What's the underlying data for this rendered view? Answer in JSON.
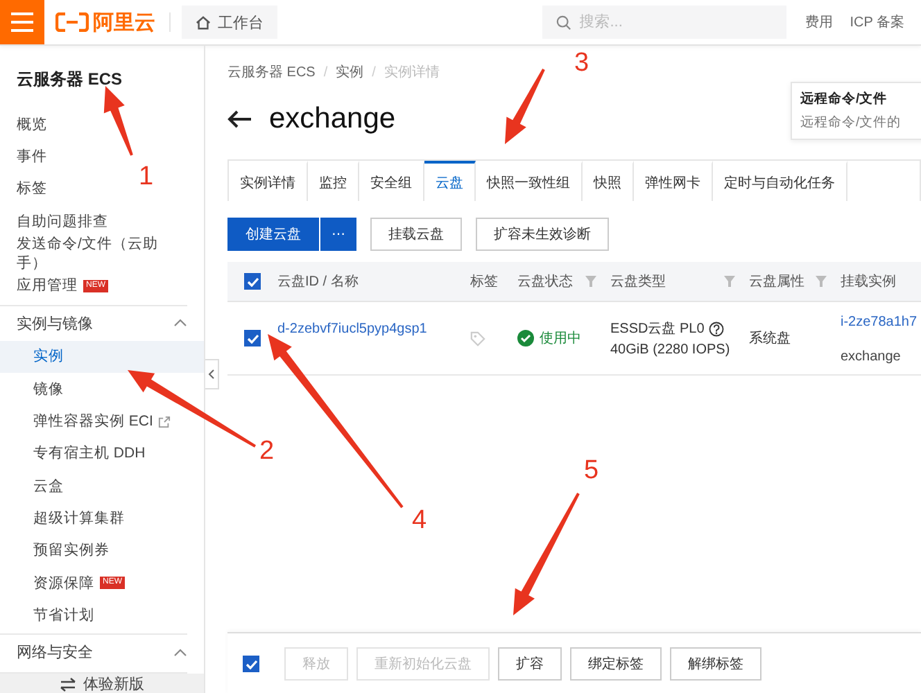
{
  "topbar": {
    "logo_text": "阿里云",
    "workbench": "工作台",
    "search": {
      "placeholder": "搜索..."
    },
    "links": [
      "费用",
      "ICP 备案"
    ]
  },
  "sidebar": {
    "title": "云服务器 ECS",
    "sections": [
      {
        "items": [
          {
            "label": "概览",
            "selected": false
          },
          {
            "label": "事件",
            "selected": false
          },
          {
            "label": "标签",
            "selected": false
          },
          {
            "label": "自助问题排查",
            "selected": false
          },
          {
            "label": "发送命令/文件（云助手）",
            "selected": false
          },
          {
            "label": "应用管理",
            "selected": false,
            "badge": "NEW"
          }
        ]
      },
      {
        "heading": "实例与镜像",
        "expanded": true,
        "items": [
          {
            "label": "实例",
            "selected": true
          },
          {
            "label": "镜像",
            "selected": false
          },
          {
            "label": "弹性容器实例 ECI",
            "selected": false,
            "external": true
          },
          {
            "label": "专有宿主机 DDH",
            "selected": false
          },
          {
            "label": "云盒",
            "selected": false
          },
          {
            "label": "超级计算集群",
            "selected": false
          },
          {
            "label": "预留实例券",
            "selected": false
          },
          {
            "label": "资源保障",
            "selected": false,
            "badge": "NEW"
          },
          {
            "label": "节省计划",
            "selected": false
          }
        ]
      },
      {
        "heading": "网络与安全",
        "expanded": true
      }
    ],
    "footer": "体验新版"
  },
  "breadcrumb": {
    "separator": "/",
    "items": [
      {
        "label": "云服务器 ECS",
        "current": false
      },
      {
        "label": "实例",
        "current": false
      },
      {
        "label": "实例详情",
        "current": true
      }
    ]
  },
  "title": "exchange",
  "popover": {
    "title": "远程命令/文件",
    "text": "远程命令/文件的"
  },
  "tabs": [
    {
      "label": "实例详情",
      "selected": false
    },
    {
      "label": "监控",
      "selected": false
    },
    {
      "label": "安全组",
      "selected": false
    },
    {
      "label": "云盘",
      "selected": true
    },
    {
      "label": "快照一致性组",
      "selected": false
    },
    {
      "label": "快照",
      "selected": false
    },
    {
      "label": "弹性网卡",
      "selected": false
    },
    {
      "label": "定时与自动化任务",
      "selected": false
    }
  ],
  "toolbar": [
    {
      "label": "创建云盘",
      "kind": "primary"
    },
    {
      "label": "⋯",
      "kind": "primary-icon"
    },
    {
      "label": "挂载云盘",
      "kind": "default"
    },
    {
      "label": "扩容未生效诊断",
      "kind": "default"
    }
  ],
  "table": {
    "header_checked": true,
    "columns": [
      {
        "label": "云盘ID / 名称",
        "filter": false
      },
      {
        "label": "标签",
        "filter": false
      },
      {
        "label": "云盘状态",
        "filter": true
      },
      {
        "label": "云盘类型",
        "filter": true
      },
      {
        "label": "云盘属性",
        "filter": true
      },
      {
        "label": "挂载实例",
        "filter": false
      }
    ],
    "rows": [
      {
        "checked": true,
        "disk_id": "d-2zebvf7iucl5pyp4gsp1",
        "status": "使用中",
        "status_ok": true,
        "type": "ESSD云盘 PL0",
        "spec": "40GiB (2280 IOPS)",
        "attribute": "系统盘",
        "instance_id": "i-2ze78a1h7",
        "instance_name": "exchange"
      }
    ]
  },
  "bottom_bar": {
    "checked": true,
    "buttons": [
      {
        "label": "释放",
        "disabled": true
      },
      {
        "label": "重新初始化云盘",
        "disabled": true
      },
      {
        "label": "扩容",
        "disabled": false
      },
      {
        "label": "绑定标签",
        "disabled": false
      },
      {
        "label": "解绑标签",
        "disabled": false
      }
    ]
  },
  "annotations": [
    {
      "label": "1"
    },
    {
      "label": "2"
    },
    {
      "label": "3"
    },
    {
      "label": "4"
    },
    {
      "label": "5"
    }
  ]
}
